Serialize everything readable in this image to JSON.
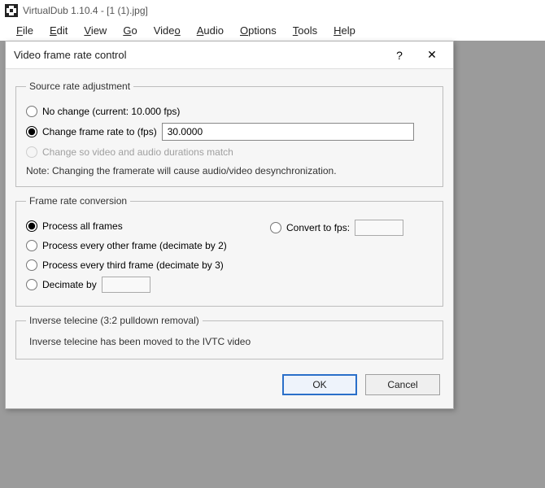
{
  "titlebar": {
    "text": "VirtualDub 1.10.4 - [1 (1).jpg]"
  },
  "menubar": {
    "file": "File",
    "edit": "Edit",
    "view": "View",
    "go": "Go",
    "video": "Video",
    "audio": "Audio",
    "options": "Options",
    "tools": "Tools",
    "help": "Help"
  },
  "dialog": {
    "title": "Video frame rate control",
    "help_glyph": "?",
    "close_glyph": "✕",
    "source_adjust": {
      "legend": "Source rate adjustment",
      "no_change": "No change (current: 10.000 fps)",
      "change_to": "Change frame rate to (fps)",
      "change_to_value": "30.0000",
      "match_durations": "Change so video and audio durations match",
      "note": "Note: Changing the framerate will cause audio/video desynchronization."
    },
    "frc": {
      "legend": "Frame rate conversion",
      "process_all": "Process all frames",
      "process_2": "Process every other frame (decimate by 2)",
      "process_3": "Process every third frame (decimate by 3)",
      "decimate_by": "Decimate by",
      "convert_to_fps": "Convert to fps:"
    },
    "ivtc": {
      "legend": "Inverse telecine (3:2 pulldown removal)",
      "text": "Inverse telecine has been moved to the IVTC video"
    },
    "buttons": {
      "ok": "OK",
      "cancel": "Cancel"
    }
  }
}
